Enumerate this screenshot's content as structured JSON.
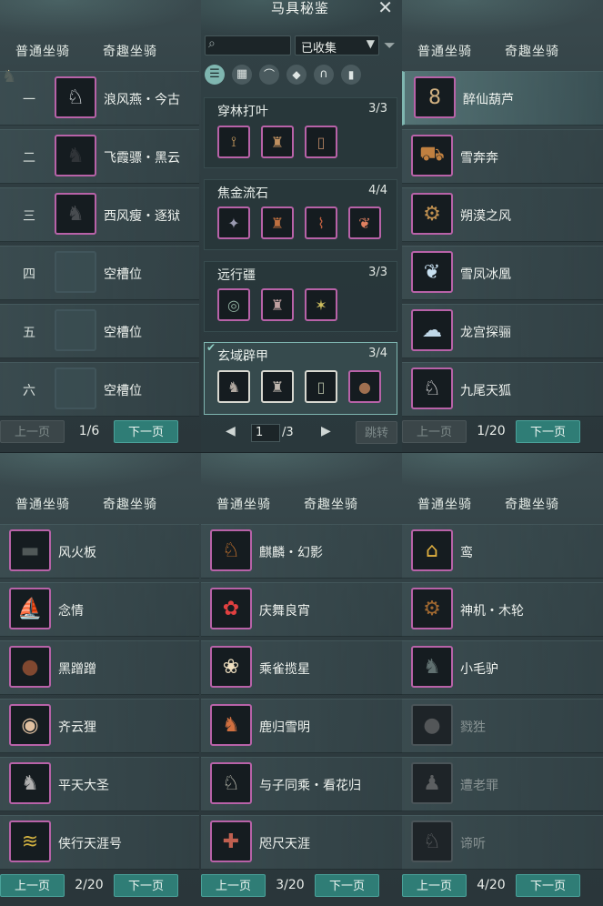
{
  "title": "马具秘鉴",
  "tabs": {
    "normal": "普通坐骑",
    "fun": "奇趣坐骑"
  },
  "pager": {
    "prev": "上一页",
    "next": "下一页"
  },
  "left_top": {
    "rows": [
      {
        "num": "一",
        "name": "浪风燕・今古",
        "icon": "white-horse-icon"
      },
      {
        "num": "二",
        "name": "飞霞骠・黑云",
        "icon": "black-horse-icon"
      },
      {
        "num": "三",
        "name": "西风瘦・逐狱",
        "icon": "dark-horse-icon"
      },
      {
        "num": "四",
        "name": "空槽位",
        "icon": "empty-slot-icon"
      },
      {
        "num": "五",
        "name": "空槽位",
        "icon": "empty-slot-icon"
      },
      {
        "num": "六",
        "name": "空槽位",
        "icon": "empty-slot-icon"
      }
    ],
    "page": "1/6"
  },
  "middle_top": {
    "search_placeholder": "",
    "filter_value": "已收集",
    "cards": [
      {
        "name": "穿林打叶",
        "count": "3/3"
      },
      {
        "name": "焦金流石",
        "count": "4/4"
      },
      {
        "name": "远行疆",
        "count": "3/3"
      },
      {
        "name": "玄域辟甲",
        "count": "3/4"
      }
    ],
    "page_input": "1",
    "page_total": "/3",
    "jump": "跳转"
  },
  "right_top": {
    "rows": [
      {
        "name": "醉仙葫芦",
        "icon": "gourd-icon"
      },
      {
        "name": "雪奔奔",
        "icon": "cart-icon"
      },
      {
        "name": "朔漠之风",
        "icon": "chariot-icon"
      },
      {
        "name": "雪凤冰凰",
        "icon": "ice-phoenix-icon"
      },
      {
        "name": "龙宫探骊",
        "icon": "cloud-icon"
      },
      {
        "name": "九尾天狐",
        "icon": "fox-icon"
      }
    ],
    "page": "1/20"
  },
  "bottom_left": {
    "rows": [
      {
        "name": "风火板",
        "icon": "skateboard-icon"
      },
      {
        "name": "念情",
        "icon": "boat-icon"
      },
      {
        "name": "黑蹭蹭",
        "icon": "round-beast-icon"
      },
      {
        "name": "齐云狸",
        "icon": "cat-icon"
      },
      {
        "name": "平天大圣",
        "icon": "monkey-icon"
      },
      {
        "name": "侠行天涯号",
        "icon": "dragon-boat-icon"
      }
    ],
    "page": "2/20"
  },
  "bottom_middle": {
    "rows": [
      {
        "name": "麒麟・幻影",
        "icon": "qilin-icon"
      },
      {
        "name": "庆舞良宵",
        "icon": "lion-dance-icon"
      },
      {
        "name": "乘雀揽星",
        "icon": "bird-icon"
      },
      {
        "name": "鹿归雪明",
        "icon": "deer-icon"
      },
      {
        "name": "与子同乘・看花归",
        "icon": "flower-horse-icon"
      },
      {
        "name": "咫尺天涯",
        "icon": "scroll-icon"
      }
    ],
    "page": "3/20"
  },
  "bottom_right": {
    "rows": [
      {
        "name": "鸾",
        "icon": "palanquin-icon",
        "owned": true
      },
      {
        "name": "神机・木轮",
        "icon": "wheel-icon",
        "owned": true
      },
      {
        "name": "小毛驴",
        "icon": "donkey-icon",
        "owned": true
      },
      {
        "name": "戮狌",
        "icon": "ape-icon",
        "owned": false
      },
      {
        "name": "遭老罪",
        "icon": "muscle-man-icon",
        "owned": false
      },
      {
        "name": "谛听",
        "icon": "wolf-icon",
        "owned": false
      }
    ],
    "page": "4/20"
  }
}
